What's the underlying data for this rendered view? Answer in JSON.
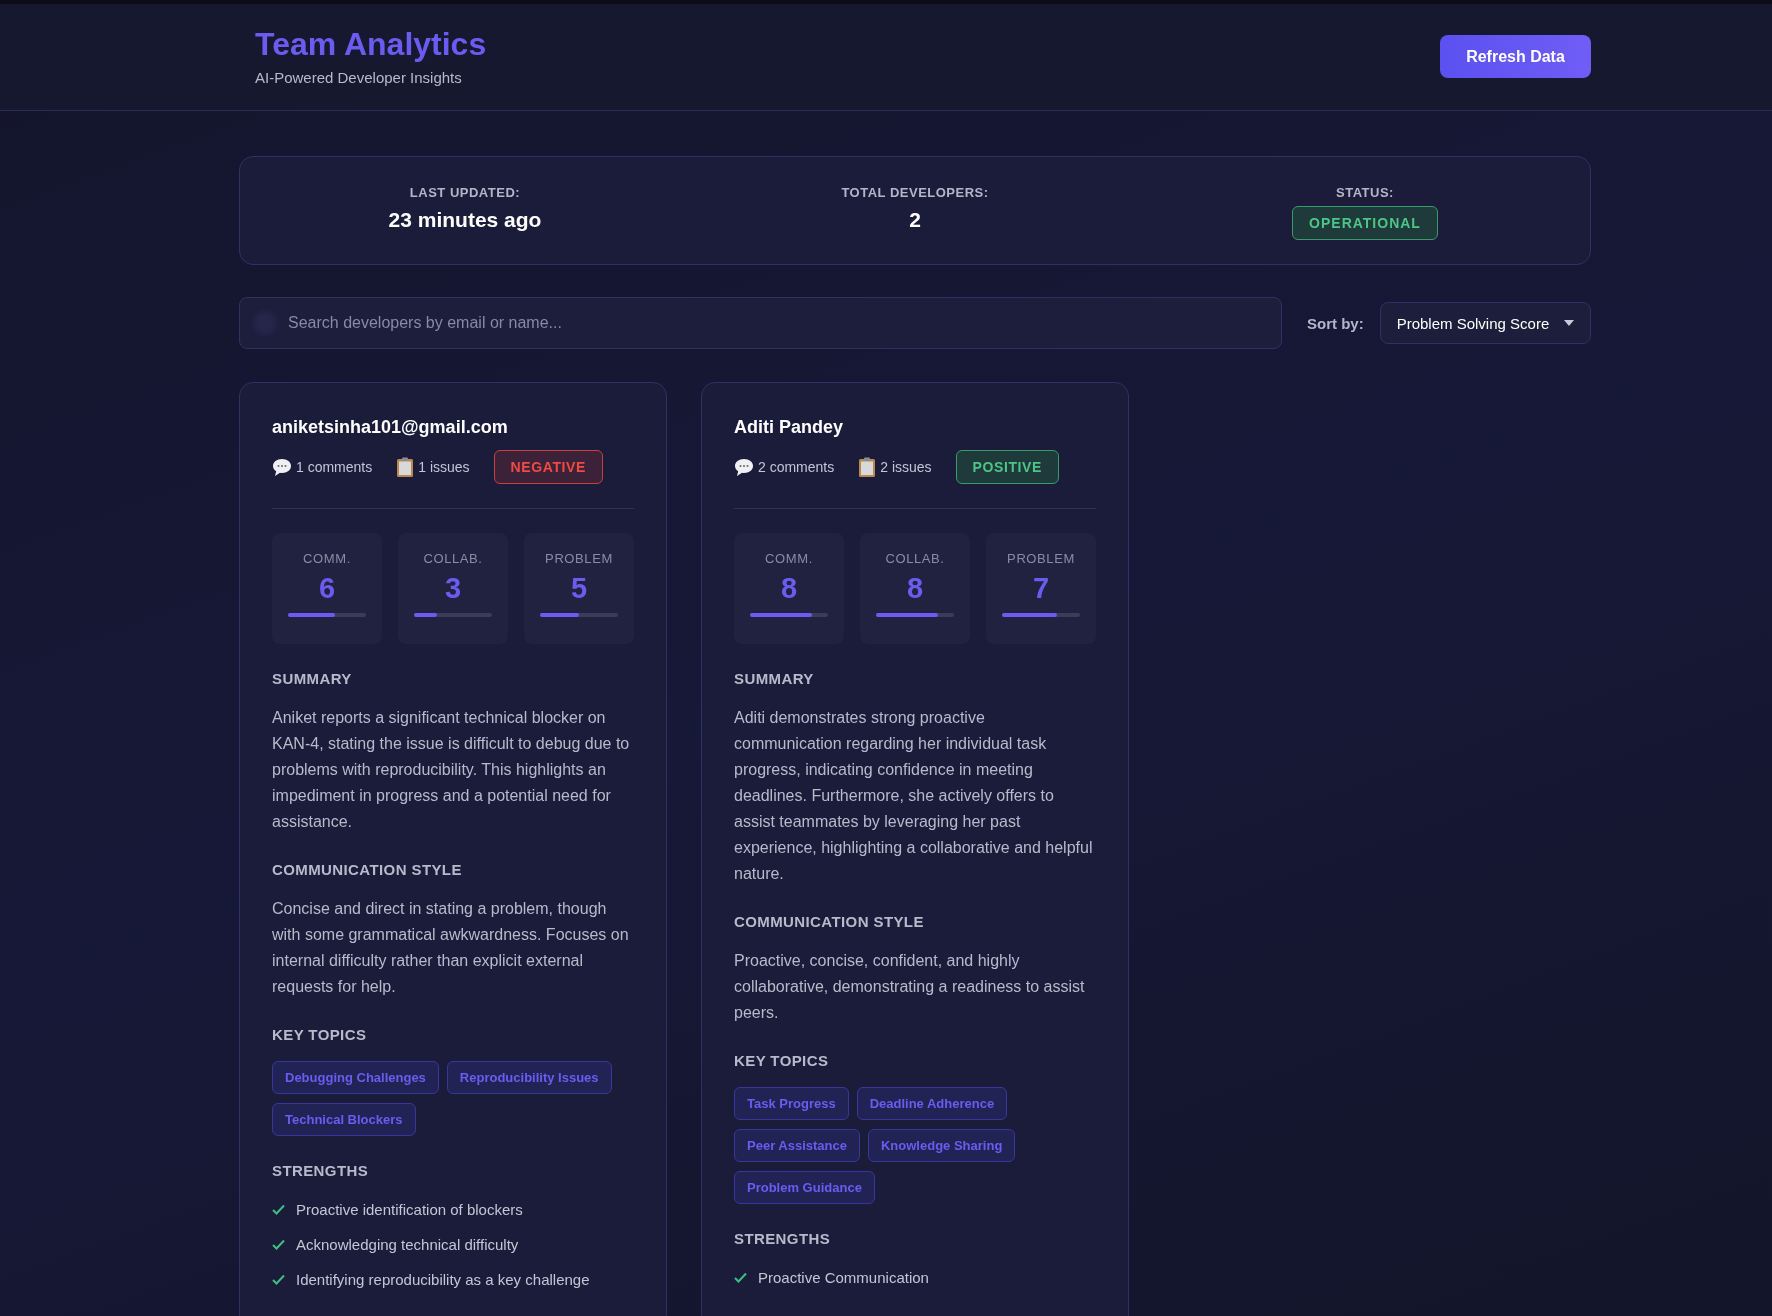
{
  "header": {
    "title": "Team Analytics",
    "subtitle": "AI-Powered Developer Insights",
    "refresh_button": "Refresh Data"
  },
  "stats": {
    "last_updated_label": "LAST UPDATED:",
    "last_updated": "23 minutes ago",
    "total_label": "TOTAL DEVELOPERS:",
    "total": "2",
    "status_label": "STATUS:",
    "status": "OPERATIONAL"
  },
  "search": {
    "placeholder": "Search developers by email or name..."
  },
  "sort": {
    "label": "Sort by:",
    "value": "Problem Solving Score"
  },
  "developers": [
    {
      "name": "aniketsinha101@gmail.com",
      "comments": "1 comments",
      "issues": "1 issues",
      "sentiment": {
        "label": "NEGATIVE",
        "kind": "negative"
      },
      "scores": [
        {
          "label": "COMM.",
          "value": "6",
          "level": 0.6
        },
        {
          "label": "COLLAB.",
          "value": "3",
          "level": 0.3
        },
        {
          "label": "PROBLEM",
          "value": "5",
          "level": 0.5
        }
      ],
      "summary_heading": "SUMMARY",
      "summary": "Aniket reports a significant technical blocker on KAN-4, stating the issue is difficult to debug due to problems with reproducibility. This highlights an impediment in progress and a potential need for assistance.",
      "style_heading": "COMMUNICATION STYLE",
      "style": "Concise and direct in stating a problem, though with some grammatical awkwardness. Focuses on internal difficulty rather than explicit external requests for help.",
      "topics_heading": "KEY TOPICS",
      "topics": [
        "Debugging Challenges",
        "Reproducibility Issues",
        "Technical Blockers"
      ],
      "strengths_heading": "STRENGTHS",
      "strengths": [
        "Proactive identification of blockers",
        "Acknowledging technical difficulty",
        "Identifying reproducibility as a key challenge"
      ]
    },
    {
      "name": "Aditi Pandey",
      "comments": "2 comments",
      "issues": "2 issues",
      "sentiment": {
        "label": "POSITIVE",
        "kind": "positive"
      },
      "scores": [
        {
          "label": "COMM.",
          "value": "8",
          "level": 0.8
        },
        {
          "label": "COLLAB.",
          "value": "8",
          "level": 0.8
        },
        {
          "label": "PROBLEM",
          "value": "7",
          "level": 0.7
        }
      ],
      "summary_heading": "SUMMARY",
      "summary": "Aditi demonstrates strong proactive communication regarding her individual task progress, indicating confidence in meeting deadlines. Furthermore, she actively offers to assist teammates by leveraging her past experience, highlighting a collaborative and helpful nature.",
      "style_heading": "COMMUNICATION STYLE",
      "style": "Proactive, concise, confident, and highly collaborative, demonstrating a readiness to assist peers.",
      "topics_heading": "KEY TOPICS",
      "topics": [
        "Task Progress",
        "Deadline Adherence",
        "Peer Assistance",
        "Knowledge Sharing",
        "Problem Guidance"
      ],
      "strengths_heading": "STRENGTHS",
      "strengths": [
        "Proactive Communication"
      ]
    }
  ]
}
